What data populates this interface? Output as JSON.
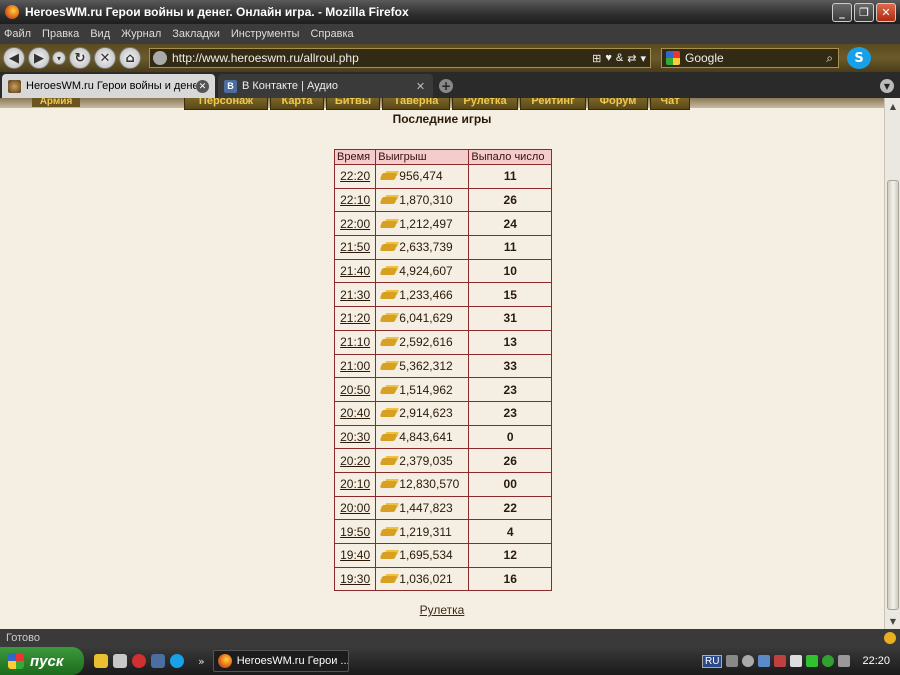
{
  "window": {
    "title": "HeroesWM.ru Герои войны и денег. Онлайн игра. - Mozilla Firefox"
  },
  "menu": [
    "Файл",
    "Правка",
    "Вид",
    "Журнал",
    "Закладки",
    "Инструменты",
    "Справка"
  ],
  "navbar": {
    "url": "http://www.heroeswm.ru/allroul.php",
    "search_engine": "Google"
  },
  "tabs": [
    {
      "label": "HeroesWM.ru Герои войны и денег. Он...",
      "active": true
    },
    {
      "label": "В Контакте | Аудио",
      "active": false
    }
  ],
  "game_nav": {
    "army": "Армия",
    "buttons": [
      "Персонаж",
      "Карта",
      "Битвы",
      "Таверна",
      "Рулетка",
      "Рейтинг",
      "Форум",
      "Чат"
    ]
  },
  "page": {
    "title": "Последние игры",
    "columns": [
      "Время",
      "Выигрыш",
      "Выпало число"
    ],
    "rows": [
      {
        "time": "22:20",
        "win": "956,474",
        "number": "11",
        "color": "black"
      },
      {
        "time": "22:10",
        "win": "1,870,310",
        "number": "26",
        "color": "black"
      },
      {
        "time": "22:00",
        "win": "1,212,497",
        "number": "24",
        "color": "black"
      },
      {
        "time": "21:50",
        "win": "2,633,739",
        "number": "11",
        "color": "black"
      },
      {
        "time": "21:40",
        "win": "4,924,607",
        "number": "10",
        "color": "black"
      },
      {
        "time": "21:30",
        "win": "1,233,466",
        "number": "15",
        "color": "black"
      },
      {
        "time": "21:20",
        "win": "6,041,629",
        "number": "31",
        "color": "black"
      },
      {
        "time": "21:10",
        "win": "2,592,616",
        "number": "13",
        "color": "black"
      },
      {
        "time": "21:00",
        "win": "5,362,312",
        "number": "33",
        "color": "black"
      },
      {
        "time": "20:50",
        "win": "1,514,962",
        "number": "23",
        "color": "red"
      },
      {
        "time": "20:40",
        "win": "2,914,623",
        "number": "23",
        "color": "red"
      },
      {
        "time": "20:30",
        "win": "4,843,641",
        "number": "0",
        "color": "green"
      },
      {
        "time": "20:20",
        "win": "2,379,035",
        "number": "26",
        "color": "black"
      },
      {
        "time": "20:10",
        "win": "12,830,570",
        "number": "00",
        "color": "green"
      },
      {
        "time": "20:00",
        "win": "1,447,823",
        "number": "22",
        "color": "black"
      },
      {
        "time": "19:50",
        "win": "1,219,311",
        "number": "4",
        "color": "black"
      },
      {
        "time": "19:40",
        "win": "1,695,534",
        "number": "12",
        "color": "red"
      },
      {
        "time": "19:30",
        "win": "1,036,021",
        "number": "16",
        "color": "red"
      }
    ],
    "footer_link": "Рулетка"
  },
  "status": {
    "text": "Готово"
  },
  "taskbar": {
    "start": "пуск",
    "task": "HeroesWM.ru Герои ...",
    "lang": "RU",
    "clock": "22:20"
  },
  "colors": {
    "red": "#d01818",
    "green": "#18d018",
    "black": "#111111",
    "header_bg": "#f4cccc",
    "border": "#8a2a2a"
  }
}
